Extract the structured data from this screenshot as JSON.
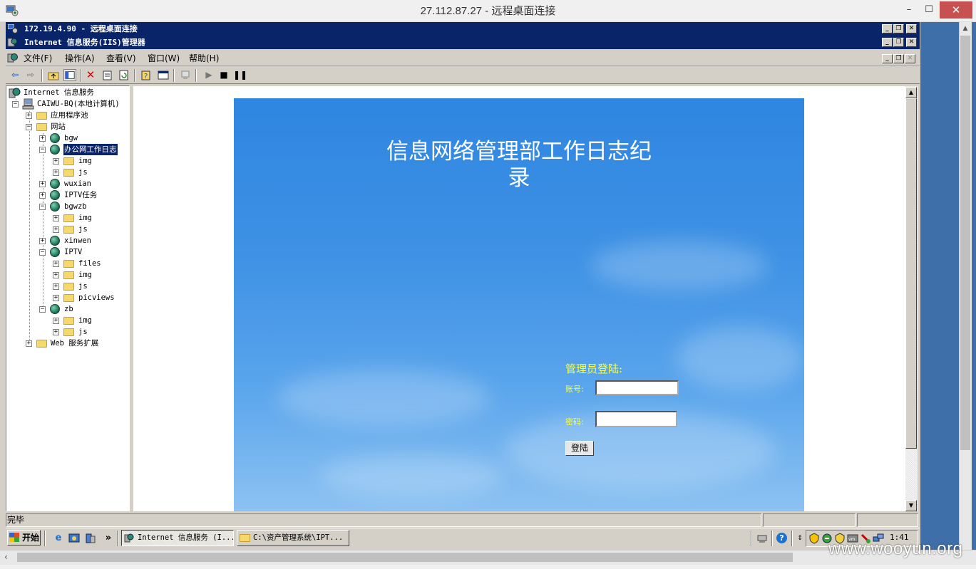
{
  "outer_window": {
    "title": "27.112.87.27 - 远程桌面连接",
    "min_glyph": "–",
    "max_glyph": "☐",
    "close_glyph": "✕"
  },
  "rdp_window": {
    "title": "172.19.4.90 - 远程桌面连接"
  },
  "iis_window": {
    "title": "Internet 信息服务(IIS)管理器"
  },
  "menu": {
    "items": [
      "文件(F)",
      "操作(A)",
      "查看(V)",
      "窗口(W)",
      "帮助(H)"
    ]
  },
  "toolbar": {
    "icons": [
      "back-icon",
      "forward-icon",
      "up-folder-icon",
      "show-tree-icon",
      "delete-icon",
      "properties-icon",
      "refresh-icon",
      "export-icon",
      "help-icon",
      "new-window-icon",
      "connect-icon",
      "start-icon",
      "stop-icon",
      "pause-icon"
    ]
  },
  "tree": {
    "root": "Internet 信息服务",
    "computer": "CAIWU-BQ(本地计算机)",
    "app_pools": "应用程序池",
    "websites": "网站",
    "sites": {
      "bgw": "bgw",
      "office_log": "办公网工作日志",
      "img": "img",
      "js": "js",
      "wuxian": "wuxian",
      "iptv_task": "IPTV任务",
      "bgwzb": "bgwzb",
      "xinwen": "xinwen",
      "iptv": "IPTV",
      "files": "files",
      "picviews": "picviews",
      "zb": "zb"
    },
    "web_ext": "Web 服务扩展"
  },
  "login_page": {
    "heading": "信息网络管理部工作日志纪录",
    "login_title": "管理员登陆:",
    "account_label": "账号:",
    "password_label": "密码:",
    "account_value": "",
    "password_value": "",
    "submit_label": "登陆",
    "colors": {
      "label": "#ffff33",
      "heading": "#ffffff",
      "background": "#3f92e5"
    }
  },
  "statusbar": {
    "text": "完毕"
  },
  "taskbar": {
    "start_label": "开始",
    "more_glyph": "»",
    "tasks": [
      "Internet 信息服务 (I...",
      "C:\\资产管理系统\\IPT..."
    ],
    "clock": "1:41"
  },
  "watermark": "www.wooyun.org"
}
